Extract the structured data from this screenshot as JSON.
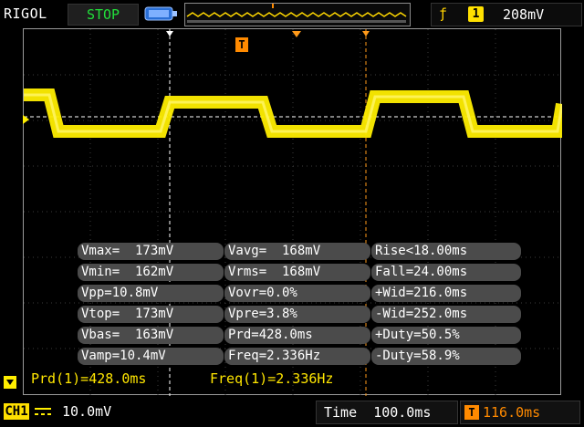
{
  "topbar": {
    "brand": "RIGOL",
    "run_state": "STOP",
    "trigger_edge_icon": "rising-edge-icon",
    "trigger_source": "1",
    "trigger_level": "208mV"
  },
  "trigger_marker_label": "T",
  "measurements": [
    [
      "Vmax=  173mV",
      "Vavg=  168mV",
      "Rise<18.00ms"
    ],
    [
      "Vmin=  162mV",
      "Vrms=  168mV",
      "Fall=24.00ms"
    ],
    [
      "Vpp=10.8mV",
      "Vovr=0.0%",
      "+Wid=216.0ms"
    ],
    [
      "Vtop=  173mV",
      "Vpre=3.8%",
      "-Wid=252.0ms"
    ],
    [
      "Vbas=  163mV",
      "Prd=428.0ms",
      "+Duty=50.5%"
    ],
    [
      "Vamp=10.4mV",
      "Freq=2.336Hz",
      "-Duty=58.9%"
    ]
  ],
  "cursor_readout": {
    "period": "Prd(1)=428.0ms",
    "frequency": "Freq(1)=2.336Hz"
  },
  "bottombar": {
    "channel": "CH1",
    "volts_div": "10.0mV",
    "time_label": "Time",
    "time_div": "100.0ms",
    "trigger_icon": "T",
    "trigger_offset": "116.0ms"
  },
  "colors": {
    "trace": "#ffee00",
    "trigger": "#ff8a00",
    "status": "#21e03a"
  }
}
